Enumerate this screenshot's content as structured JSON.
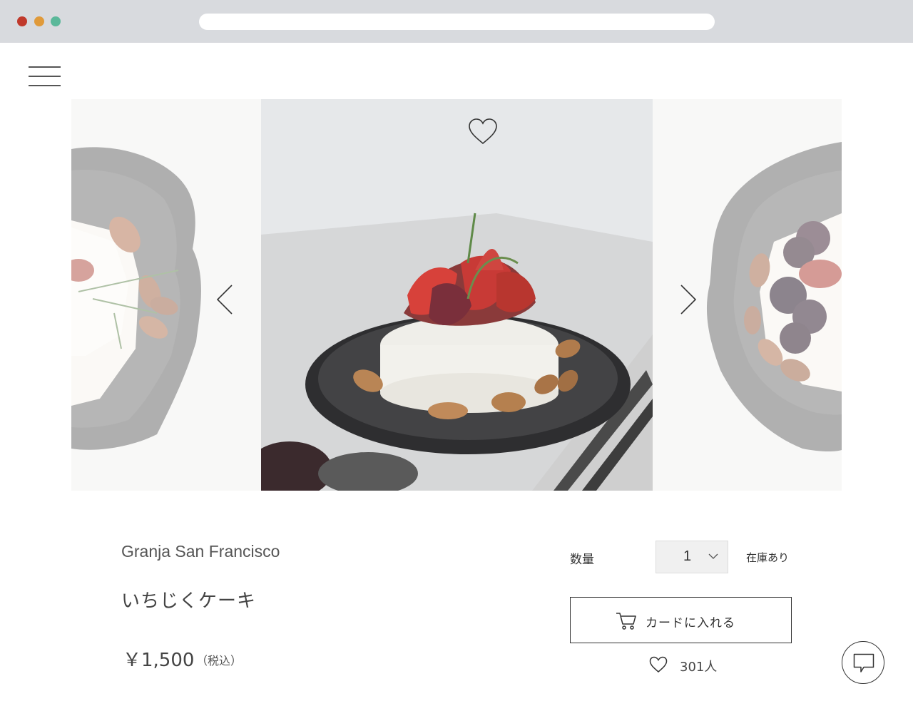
{
  "product": {
    "brand": "Granja San Francisco",
    "name": "いちじくケーキ",
    "price": "￥1,500",
    "tax_note": "（税込）"
  },
  "purchase": {
    "quantity_label": "数量",
    "quantity_value": "1",
    "stock_status": "在庫あり",
    "add_to_cart_label": "カードに入れる",
    "likes_count": "301人"
  },
  "icons": {
    "menu": "hamburger-menu-icon",
    "favorite": "heart-outline-icon",
    "prev": "chevron-left-icon",
    "next": "chevron-right-icon",
    "dropdown": "chevron-down-icon",
    "cart": "shopping-cart-icon",
    "like": "heart-outline-icon",
    "chat": "chat-bubble-icon"
  },
  "colors": {
    "chrome": "#d8dade",
    "dot_red": "#c0392b",
    "dot_orange": "#e09a3a",
    "dot_green": "#5bb89a",
    "select_bg": "#f0f0f0"
  }
}
